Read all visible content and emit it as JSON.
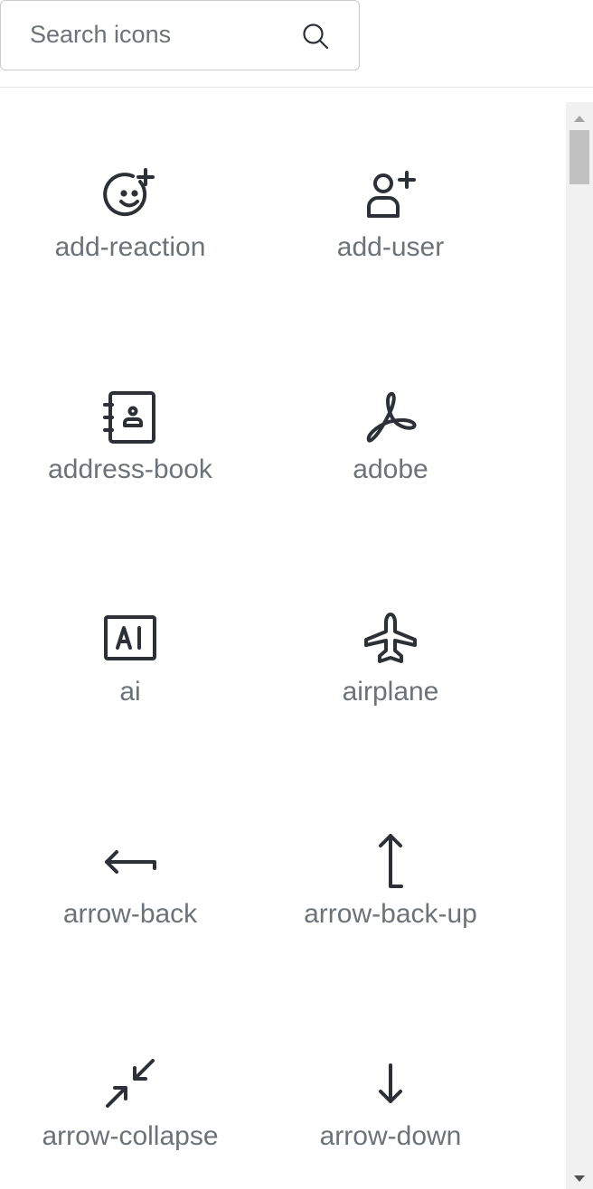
{
  "search": {
    "placeholder": "Search icons",
    "value": "",
    "button_icon": "search-icon"
  },
  "colors": {
    "icon_stroke": "#2d3137",
    "label": "#6d7278",
    "border": "#c7cacf",
    "divider": "#e3e5e8",
    "scrollbar_track": "#f1f1f1",
    "scrollbar_thumb": "#c1c1c1"
  },
  "icons": [
    {
      "label": "add-reaction",
      "icon": "add-reaction-icon"
    },
    {
      "label": "add-user",
      "icon": "add-user-icon"
    },
    {
      "label": "address-book",
      "icon": "address-book-icon"
    },
    {
      "label": "adobe",
      "icon": "adobe-icon"
    },
    {
      "label": "ai",
      "icon": "ai-icon"
    },
    {
      "label": "airplane",
      "icon": "airplane-icon"
    },
    {
      "label": "arrow-back",
      "icon": "arrow-back-icon"
    },
    {
      "label": "arrow-back-up",
      "icon": "arrow-back-up-icon"
    },
    {
      "label": "arrow-collapse",
      "icon": "arrow-collapse-icon"
    },
    {
      "label": "arrow-down",
      "icon": "arrow-down-icon"
    }
  ]
}
